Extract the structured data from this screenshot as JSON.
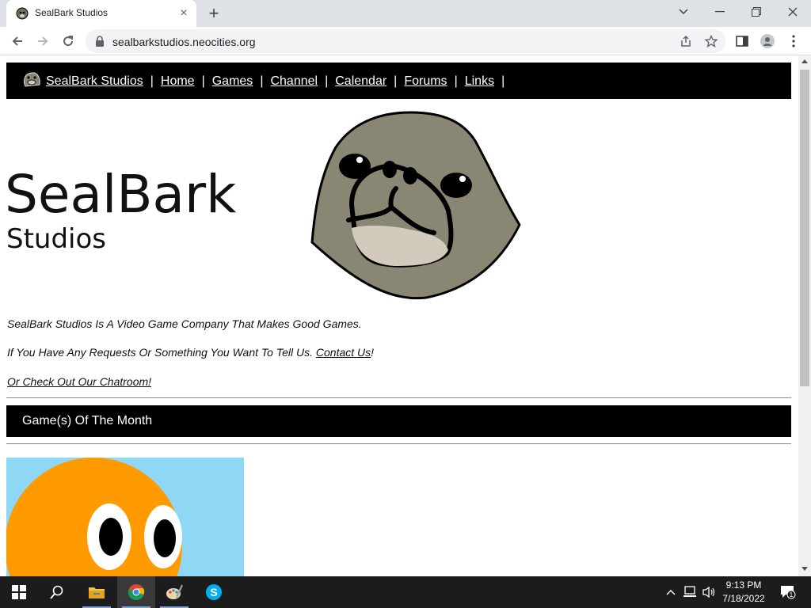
{
  "browser": {
    "tab_title": "SealBark Studios",
    "close_tab_glyph": "×",
    "new_tab_glyph": "+",
    "url": "sealbarkstudios.neocities.org"
  },
  "site": {
    "nav": {
      "brand": "SealBark Studios",
      "links": [
        "Home",
        "Games",
        "Channel",
        "Calendar",
        "Forums",
        "Links"
      ],
      "separator": "|"
    },
    "hero": {
      "title": "SealBark",
      "subtitle": "Studios"
    },
    "intro": {
      "line1": "SealBark Studios Is A Video Game Company That Makes Good Games.",
      "line2_prefix": "If You Have Any Requests Or Something You Want To Tell Us. ",
      "line2_link": "Contact Us",
      "line2_suffix": "!",
      "line3_link": "Or Check Out Our Chatroom!"
    },
    "section_title": "Game(s) Of The Month"
  },
  "taskbar": {
    "time": "9:13 PM",
    "date": "7/18/2022",
    "notification_count": "1",
    "icons": [
      "windows-start-icon",
      "search-icon",
      "file-explorer-icon",
      "chrome-icon",
      "paint-icon",
      "skype-icon"
    ]
  },
  "colors": {
    "nav_bg": "#000000",
    "seal_body": "#8a8674",
    "seal_belly": "#cfc8b8",
    "thumb_sky": "#8fd8f5",
    "thumb_orange": "#ff9a00"
  }
}
